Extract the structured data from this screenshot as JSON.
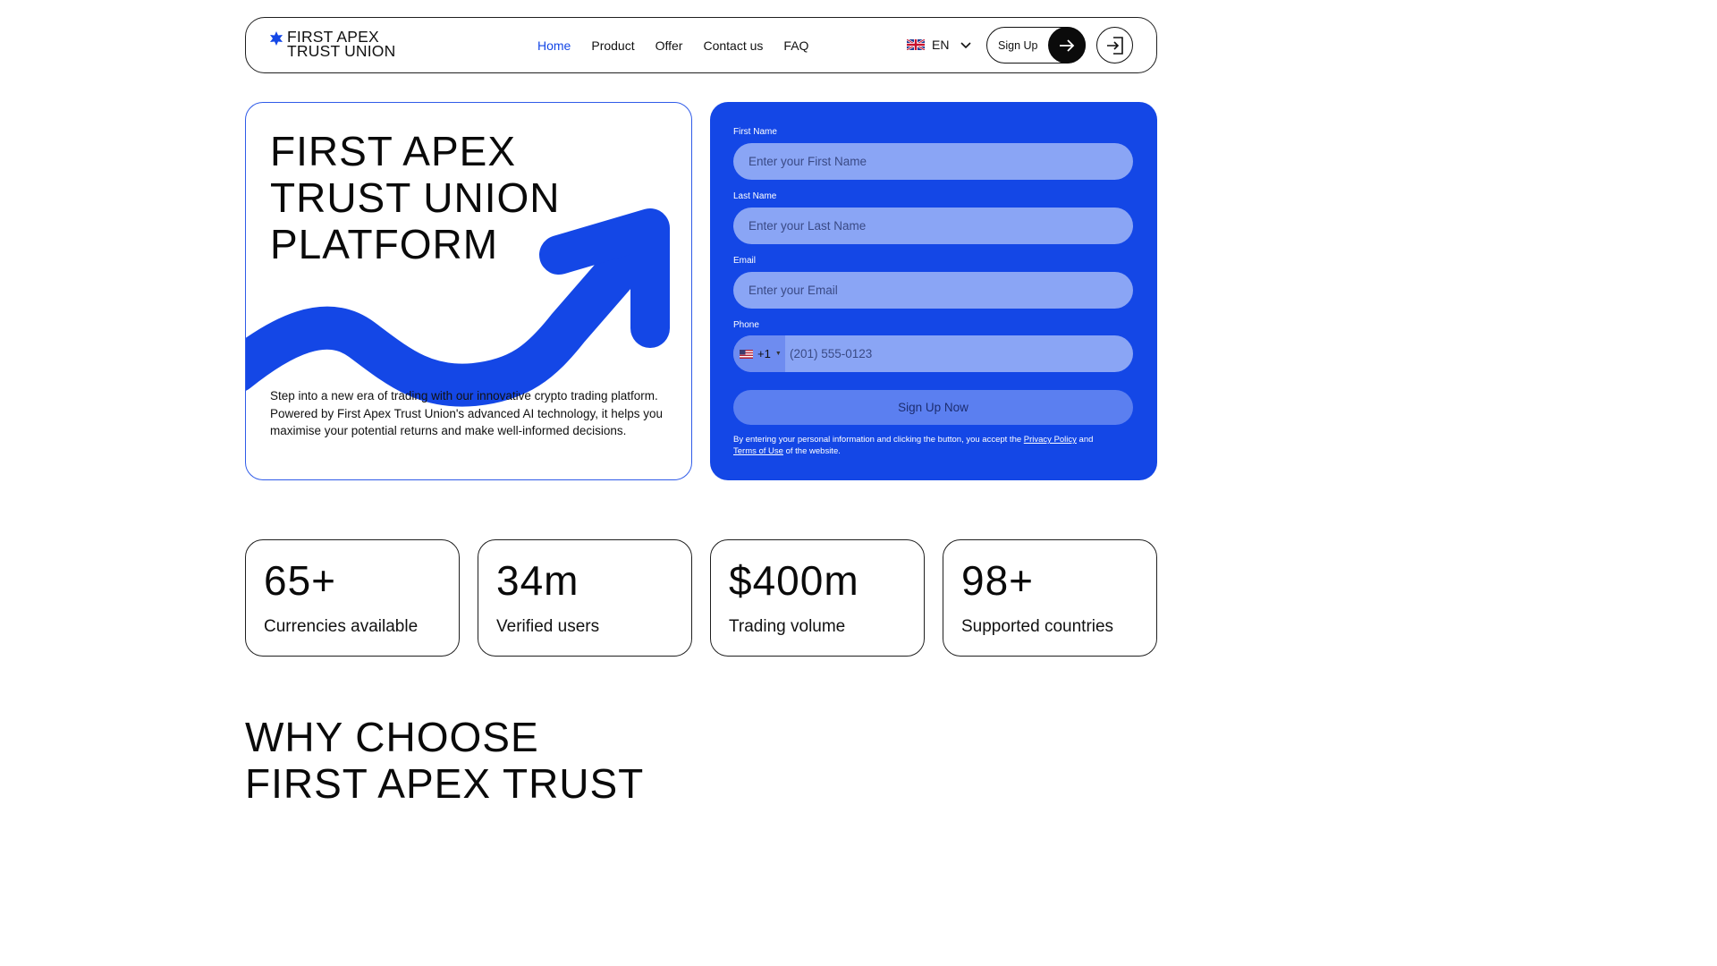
{
  "header": {
    "logo_line1": "FIRST APEX",
    "logo_line2": "TRUST UNION",
    "nav": [
      {
        "label": "Home",
        "active": true
      },
      {
        "label": "Product",
        "active": false
      },
      {
        "label": "Offer",
        "active": false
      },
      {
        "label": "Contact us",
        "active": false
      },
      {
        "label": "FAQ",
        "active": false
      }
    ],
    "language": "EN",
    "signup_label": "Sign Up",
    "icons": {
      "logo": "star-icon",
      "lang_flag": "uk-flag-icon",
      "lang_caret": "chevron-down-icon",
      "signup": "arrow-right-icon",
      "login": "login-icon"
    }
  },
  "hero": {
    "title_lines": [
      "FIRST APEX",
      "TRUST UNION",
      "PLATFORM"
    ],
    "description": "Step into a new era of trading with our innovative crypto trading platform. Powered by First Apex Trust Union's advanced AI technology, it helps you maximise your potential returns and make well-informed decisions."
  },
  "form": {
    "first_name_label": "First Name",
    "first_name_placeholder": "Enter your First Name",
    "last_name_label": "Last Name",
    "last_name_placeholder": "Enter your Last Name",
    "email_label": "Email",
    "email_placeholder": "Enter your Email",
    "phone_label": "Phone",
    "phone_code": "+1",
    "phone_placeholder": "(201) 555-0123",
    "submit_label": "Sign Up Now",
    "consent_prefix": "By entering your personal information and clicking the button, you accept the",
    "privacy_link": "Privacy Policy",
    "consent_and": "and",
    "terms_link": "Terms of Use",
    "consent_suffix": "of the website."
  },
  "stats": [
    {
      "value": "65+",
      "caption": "Currencies available"
    },
    {
      "value": "34m",
      "caption": "Verified users"
    },
    {
      "value": "$400m",
      "caption": "Trading volume"
    },
    {
      "value": "98+",
      "caption": "Supported countries"
    }
  ],
  "why": {
    "title_lines": [
      "WHY CHOOSE",
      "FIRST APEX TRUST"
    ]
  },
  "colors": {
    "accent": "#1447e6",
    "input_bg": "#8aa5f5",
    "button_bg": "#5b7ff0"
  }
}
